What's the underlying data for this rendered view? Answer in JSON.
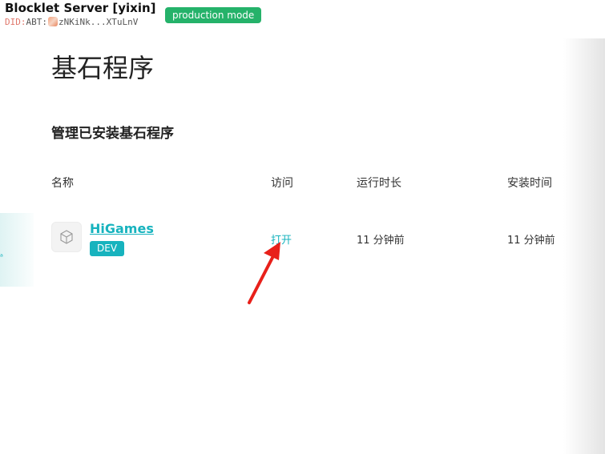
{
  "header": {
    "server_title": "Blocklet Server [yixin]",
    "mode_badge": "production mode",
    "did_prefix": "DID:",
    "did_type": "ABT:",
    "did_value": "zNKiNk...XTuLnV"
  },
  "page": {
    "title": "基石程序",
    "section_title": "管理已安装基石程序"
  },
  "table": {
    "columns": [
      "名称",
      "访问",
      "运行时长",
      "安装时间"
    ],
    "rows": [
      {
        "name": "HiGames",
        "badge": "DEV",
        "access": "打开",
        "uptime": "11 分钟前",
        "installed": "11 分钟前"
      }
    ]
  },
  "sidebar_edge": {
    "glyph": "ᵃ"
  },
  "colors": {
    "accent": "#17b3be",
    "mode_badge": "#25b26a",
    "annotation_arrow": "#e8201a"
  },
  "icons": [
    "blocklet-cube-icon",
    "did-avatar-icon",
    "red-pointer-arrow"
  ]
}
